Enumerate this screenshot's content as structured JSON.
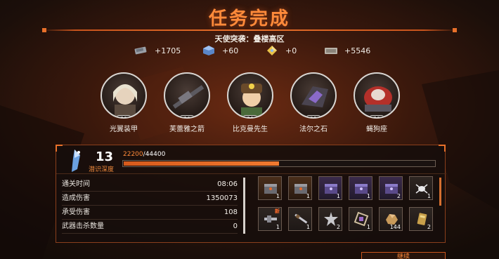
{
  "header": {
    "title": "任务完成",
    "subtitle": "天使突袭：叠楼高区"
  },
  "rewards": [
    {
      "icon": "cash-stack-icon",
      "value": "+1705"
    },
    {
      "icon": "blue-cube-icon",
      "value": "+60"
    },
    {
      "icon": "yellow-crystal-icon",
      "value": "+0"
    },
    {
      "icon": "silver-bar-icon",
      "value": "+5546"
    }
  ],
  "characters": [
    {
      "name": "光翼装甲",
      "level": "30"
    },
    {
      "name": "芙蕾雅之箭",
      "level": "30"
    },
    {
      "name": "比克曼先生",
      "level": "30"
    },
    {
      "name": "法尔之石",
      "level": "22"
    },
    {
      "name": "蝇狗座",
      "level": "30"
    }
  ],
  "depth": {
    "value": "13",
    "label": "潜识深度"
  },
  "xp": {
    "current": "22200",
    "separator": "/",
    "max": "44400",
    "fraction": 0.5
  },
  "stats": [
    {
      "label": "通关时间",
      "value": "08:06"
    },
    {
      "label": "造成伤害",
      "value": "1350073"
    },
    {
      "label": "承受伤害",
      "value": "108"
    },
    {
      "label": "武器击杀数量",
      "value": "0"
    }
  ],
  "items": [
    {
      "icon": "gray-box-icon",
      "count": "1",
      "tone": "orange"
    },
    {
      "icon": "gray-box-icon",
      "count": "1",
      "tone": "orange"
    },
    {
      "icon": "purple-box-icon",
      "count": "1",
      "tone": "purple"
    },
    {
      "icon": "purple-box-icon",
      "count": "1",
      "tone": "purple"
    },
    {
      "icon": "purple-box-icon",
      "count": "2",
      "tone": "purple"
    },
    {
      "icon": "spider-emblem-icon",
      "count": "1",
      "tone": "plain"
    },
    {
      "icon": "weapon-chip-icon",
      "count": "1",
      "tone": "plain",
      "badge": "新"
    },
    {
      "icon": "blade-icon",
      "count": "1",
      "tone": "plain"
    },
    {
      "icon": "star-core-icon",
      "count": "2",
      "tone": "plain"
    },
    {
      "icon": "gem-frame-icon",
      "count": "1",
      "tone": "plain"
    },
    {
      "icon": "ore-chunk-icon",
      "count": "144",
      "tone": "plain"
    },
    {
      "icon": "gold-card-icon",
      "count": "2",
      "tone": "plain"
    }
  ],
  "footer": {
    "next_label": "继续"
  },
  "colors": {
    "accent": "#e8702a",
    "title": "#ff8a3a",
    "depth_label": "#f08a3c"
  }
}
